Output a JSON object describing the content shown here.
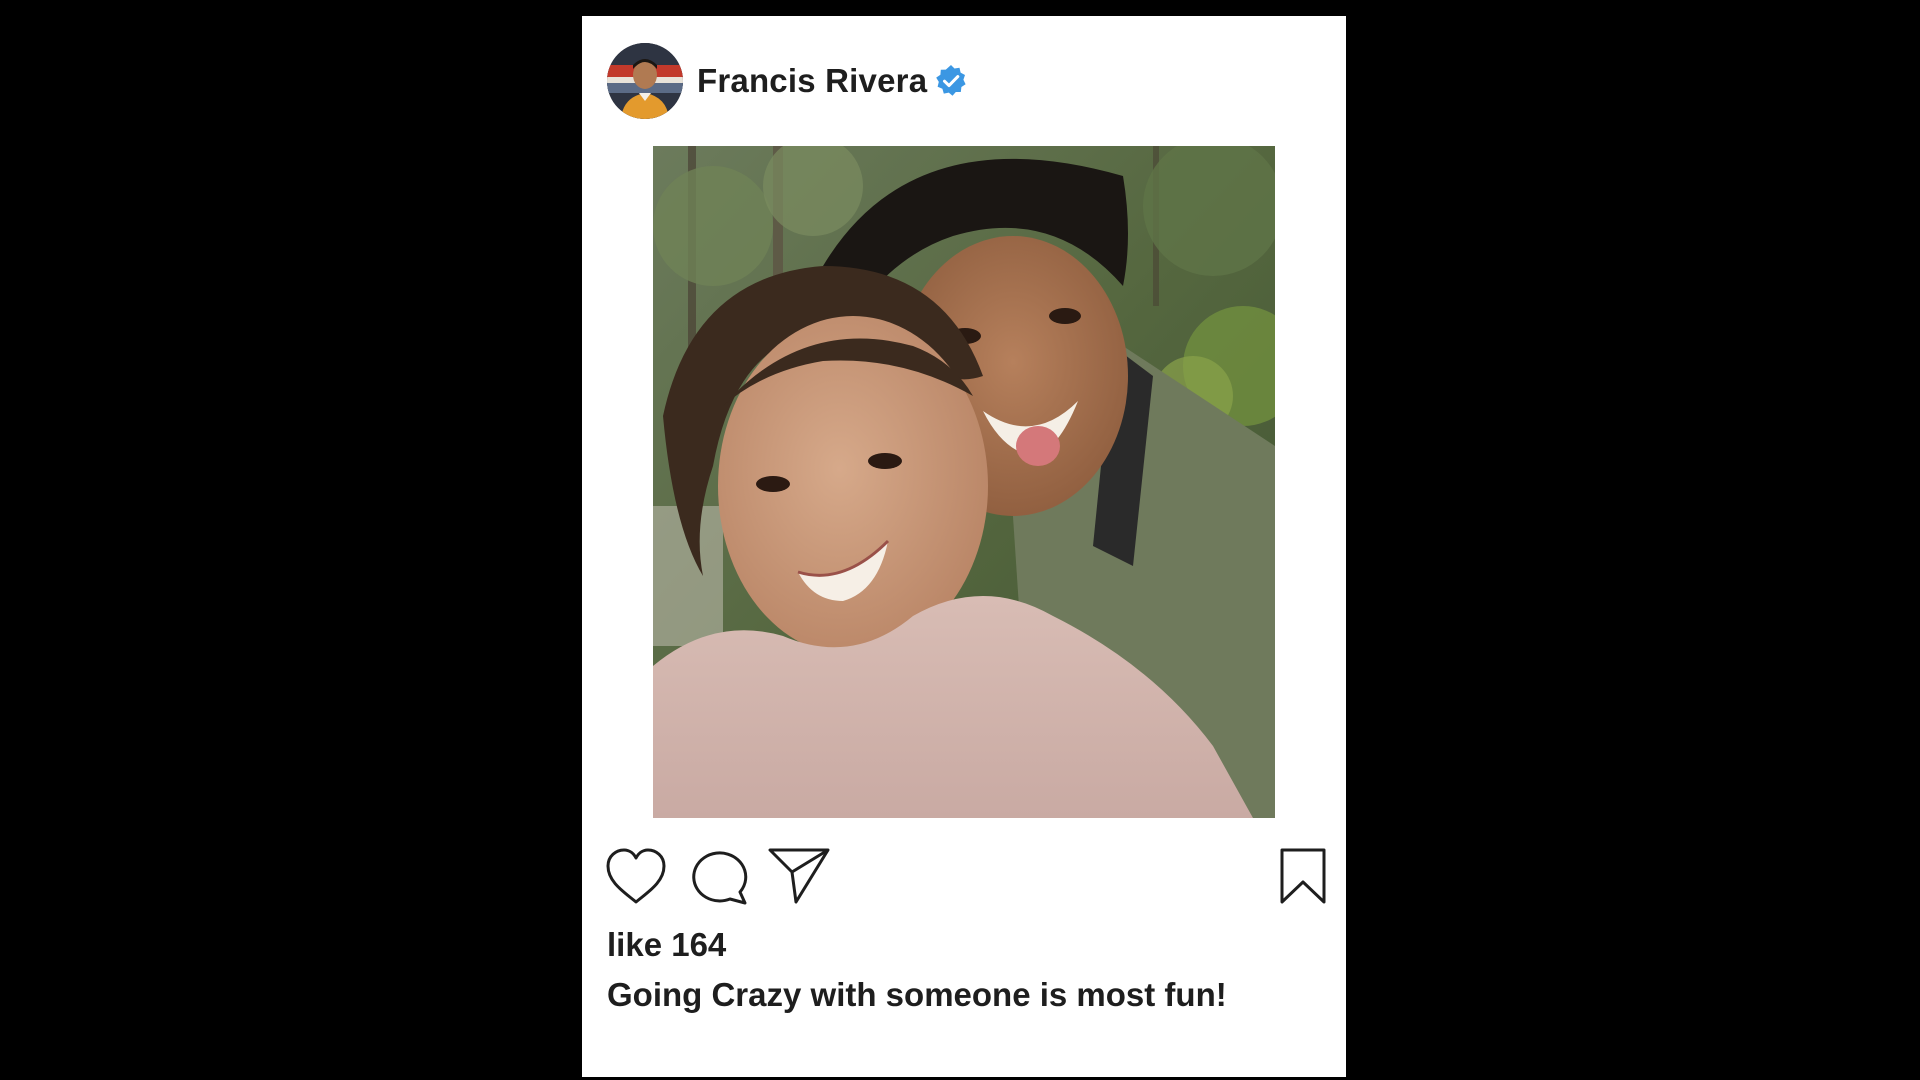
{
  "post": {
    "username": "Francis Rivera",
    "verified": true,
    "likes_text": "like 164",
    "caption": "Going Crazy with someone is most fun!"
  },
  "icons": {
    "avatar": "profile-photo",
    "verified": "verified-badge-icon",
    "like": "heart-icon",
    "comment": "comment-bubble-icon",
    "share": "send-paper-plane-icon",
    "save": "bookmark-icon"
  },
  "colors": {
    "background": "#000000",
    "card": "#ffffff",
    "text": "#1e1e1e",
    "verified_badge": "#3b97e3"
  }
}
